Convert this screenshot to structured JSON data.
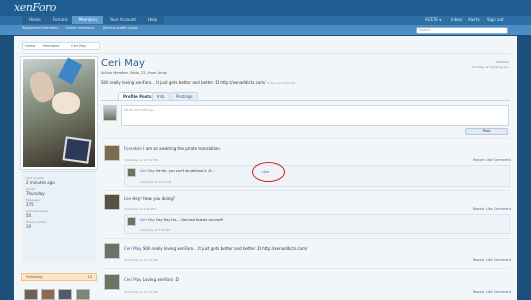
{
  "header": {
    "logo": "xenForo",
    "tabs": [
      "Home",
      "Forums",
      "Members",
      "Your Account",
      "Help"
    ],
    "active_tab": 2,
    "user_links": [
      "ACETE ▾",
      "Inbox",
      "Alerts",
      "Sign out"
    ],
    "sub_links": [
      "Registered members",
      "Online members",
      "Recent profile posts"
    ],
    "search_placeholder": "Search..."
  },
  "breadcrumb": [
    "Home",
    "Members",
    "Ceri May"
  ],
  "profile": {
    "name": "Ceri May",
    "meta": "Active Member, Male, 22, from Array",
    "status": "Still really loving xenForo... It just gets better and better :D http://xenaddicts.com/",
    "status_time": "Friday at 10:42 PM",
    "top_links": [
      "Unfollow",
      "Ceri May is following you"
    ],
    "tabs": [
      "Profile Posts",
      "Info",
      "Postings"
    ],
    "active_tab": 0
  },
  "sidebar": {
    "fields": [
      {
        "label": "Last Activity",
        "value": "2 minutes ago"
      },
      {
        "label": "Joined",
        "value": "Thursday"
      },
      {
        "label": "Messages",
        "value": "275"
      },
      {
        "label": "Likes Received",
        "value": "50"
      },
      {
        "label": "Trophy points",
        "value": "28"
      }
    ],
    "following_label": "Following",
    "following_count": "10"
  },
  "composer": {
    "placeholder": "Write something...",
    "post_label": "Post"
  },
  "posts": [
    {
      "author": "Forsaken",
      "text": "I am so awaiting the pirate translation.",
      "time": "Yesterday at 10:11 PM",
      "comment_author": "Ceri May",
      "comment_text": "He He, you can't do without it :D...",
      "comment_time": "Yesterday at 10:14 PM",
      "like_label": "Like"
    },
    {
      "author": "Lee",
      "text": "Hey! How you doing?",
      "time": "Yesterday at 5:06 PM",
      "comment_author": "Ceri May",
      "comment_text": "Hey Hey Ho.... Not bad thanks yourself!",
      "comment_time": "Yesterday at 5:32 PM"
    },
    {
      "author": "Ceri May",
      "text": "Still really loving xenForo... It just gets better and better :D http://xenaddicts.com/",
      "time": "Yesterday at 12:43 PM"
    },
    {
      "author": "Ceri May",
      "text": "Loving xenForo :D",
      "time": "Yesterday at 11:35 AM"
    }
  ],
  "actions": [
    "Report",
    "Like",
    "Comment"
  ],
  "colors": {
    "brand": "#1f5c8f",
    "accent": "#2f5e8c",
    "annotation": "#d01e1e"
  }
}
